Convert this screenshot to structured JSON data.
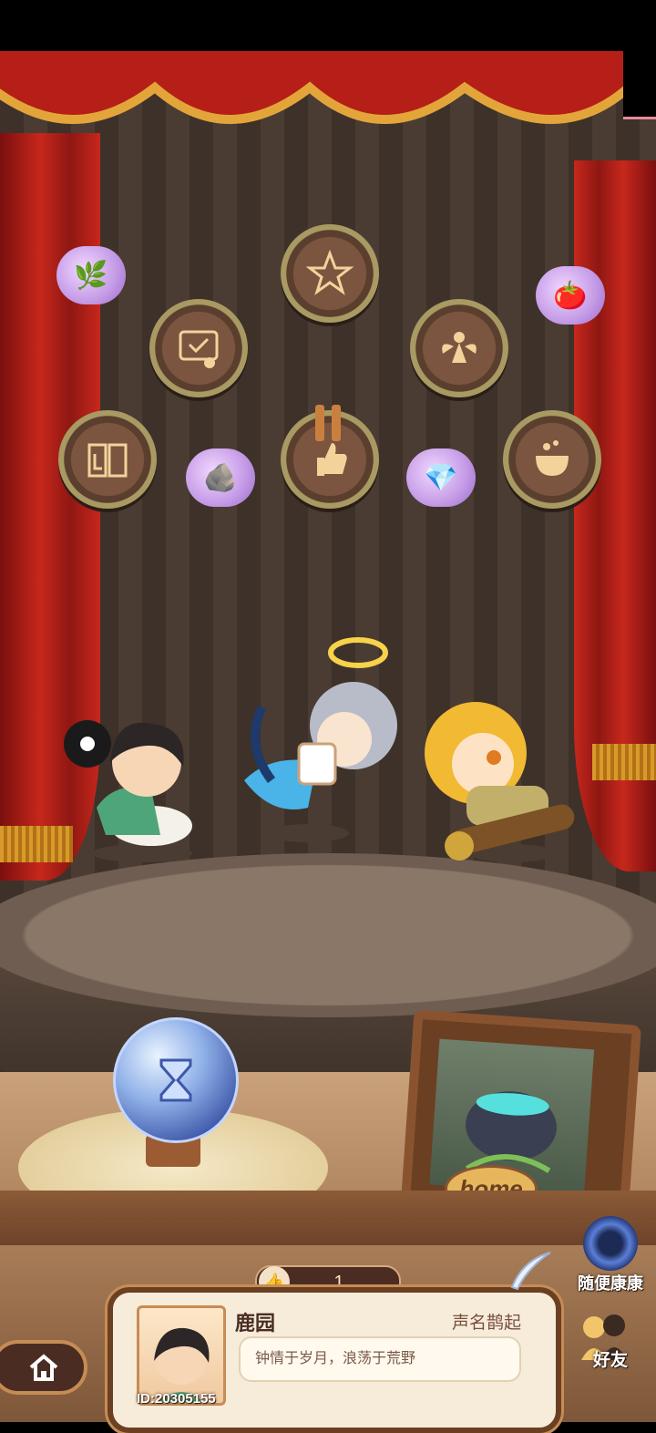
{
  "stage": {
    "badges": [
      {
        "name": "badge-craft-icon"
      },
      {
        "name": "badge-certificate-icon"
      },
      {
        "name": "badge-fairy-icon"
      },
      {
        "name": "badge-book-icon"
      },
      {
        "name": "badge-thumbsup-icon"
      },
      {
        "name": "badge-cauldron-icon"
      }
    ],
    "rewards": [
      {
        "name": "reward-herb-icon",
        "glyph": "🌿"
      },
      {
        "name": "reward-tomato-icon",
        "glyph": "🍅"
      },
      {
        "name": "reward-ore-icon",
        "glyph": "🪨"
      },
      {
        "name": "reward-crystal-icon",
        "glyph": "💎"
      }
    ]
  },
  "home_frame": {
    "label": "home"
  },
  "like_bar": {
    "count": "1"
  },
  "profile": {
    "name": "鹿园",
    "rank": "声名鹊起",
    "motto": "钟情于岁月，浪荡于荒野",
    "id": "ID:20305155"
  },
  "side": {
    "random_visit": "随便康康",
    "friends": "好友"
  },
  "colors": {
    "curtain": "#c7271c",
    "wood": "#6b3f22",
    "accent": "#d89a2a"
  }
}
